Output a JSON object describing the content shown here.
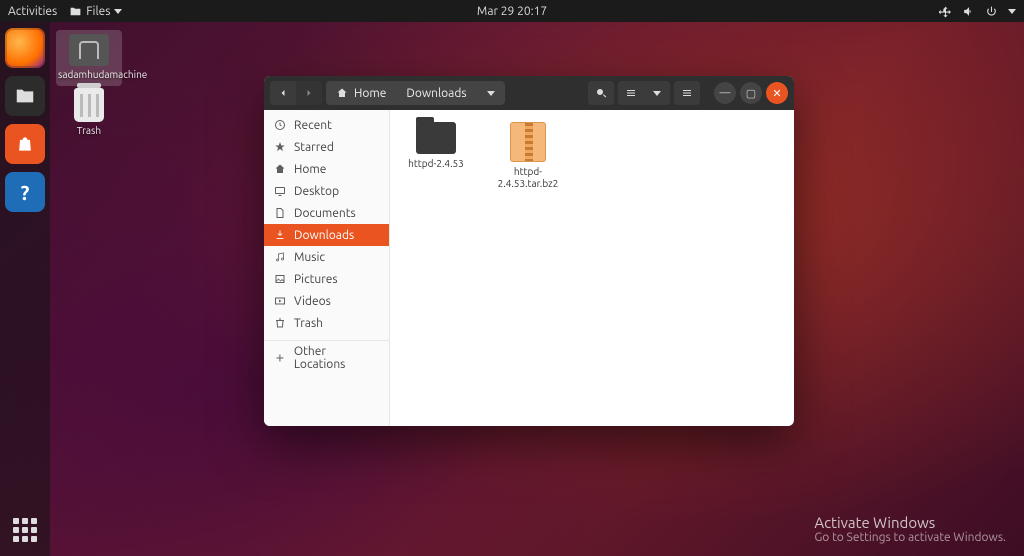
{
  "topbar": {
    "activities": "Activities",
    "app_label": "Files",
    "datetime": "Mar 29  20:17"
  },
  "desktop": {
    "home_label": "sadamhudamachine",
    "trash_label": "Trash"
  },
  "window": {
    "path": {
      "root": "Home",
      "current": "Downloads"
    },
    "sidebar": [
      {
        "label": "Recent",
        "icon": "clock"
      },
      {
        "label": "Starred",
        "icon": "star"
      },
      {
        "label": "Home",
        "icon": "home"
      },
      {
        "label": "Desktop",
        "icon": "desktop"
      },
      {
        "label": "Documents",
        "icon": "doc"
      },
      {
        "label": "Downloads",
        "icon": "download",
        "active": true
      },
      {
        "label": "Music",
        "icon": "music"
      },
      {
        "label": "Pictures",
        "icon": "picture"
      },
      {
        "label": "Videos",
        "icon": "video"
      },
      {
        "label": "Trash",
        "icon": "trash"
      }
    ],
    "other_locations": "Other Locations",
    "files": [
      {
        "name": "httpd-2.4.53",
        "type": "folder"
      },
      {
        "name": "httpd-2.4.53.tar.bz2",
        "type": "archive"
      }
    ]
  },
  "watermark": {
    "title": "Activate Windows",
    "sub": "Go to Settings to activate Windows."
  }
}
